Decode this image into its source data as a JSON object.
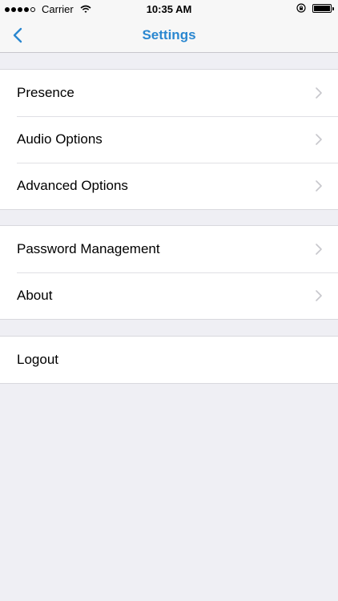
{
  "status_bar": {
    "carrier": "Carrier",
    "time": "10:35 AM"
  },
  "nav": {
    "title": "Settings",
    "back_icon": "chevron-left-icon"
  },
  "colors": {
    "accent": "#2a87d0",
    "background": "#efeff4",
    "chevron": "#c7c7cc"
  },
  "groups": [
    {
      "items": [
        {
          "label": "Presence"
        },
        {
          "label": "Audio Options"
        },
        {
          "label": "Advanced Options"
        }
      ]
    },
    {
      "items": [
        {
          "label": "Password Management"
        },
        {
          "label": "About"
        }
      ]
    },
    {
      "items": [
        {
          "label": "Logout"
        }
      ]
    }
  ]
}
